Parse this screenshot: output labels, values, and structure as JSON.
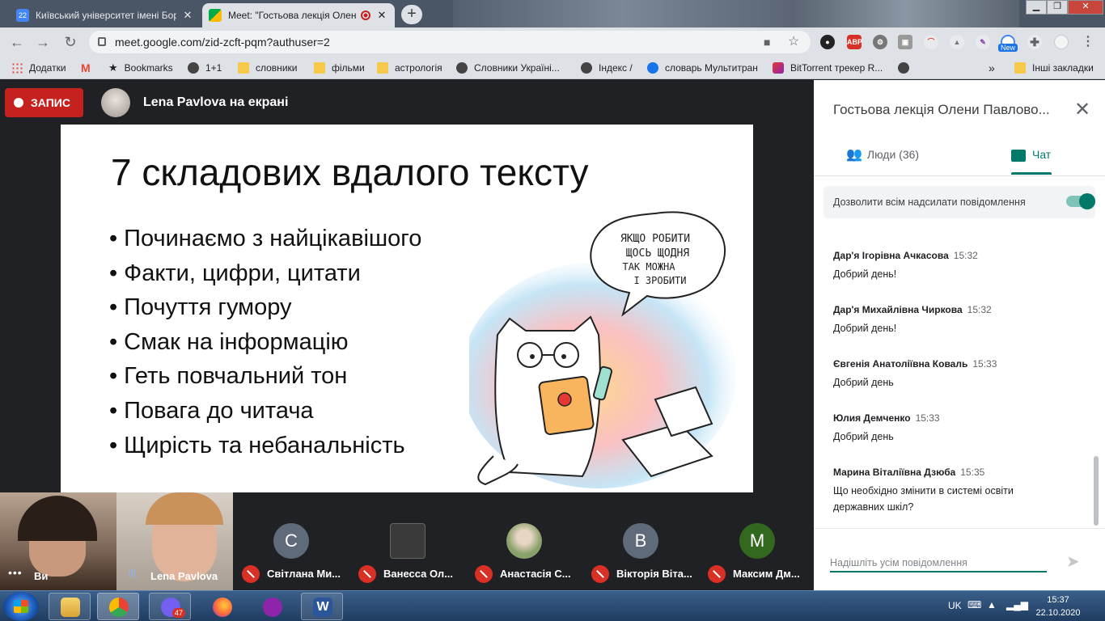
{
  "browser": {
    "tabs": [
      {
        "title": "Київський університет імені Бор",
        "active": false,
        "favicon_color": "#4285f4",
        "favicon_text": "22"
      },
      {
        "title": "Meet: \"Гостьова лекція Олен",
        "active": true,
        "favicon_color": "#00ac47",
        "recording": true
      }
    ],
    "window_controls": [
      "minimize",
      "restore",
      "close"
    ],
    "url": "meet.google.com/zid-zcft-pqm?authuser=2",
    "extension_new_badge": "New",
    "bookmarks": [
      {
        "label": "Додатки",
        "icon": "apps-grid-icon"
      },
      {
        "label": "",
        "icon": "gmail-icon"
      },
      {
        "label": "Bookmarks",
        "icon": "star-icon"
      },
      {
        "label": "1+1",
        "icon": "globe-icon"
      },
      {
        "label": "словники",
        "icon": "folder-icon"
      },
      {
        "label": "фільми",
        "icon": "folder-icon"
      },
      {
        "label": "астрологія",
        "icon": "folder-icon"
      },
      {
        "label": "Словники Україні...",
        "icon": "globe-icon"
      },
      {
        "label": "Індекс /",
        "icon": "globe-icon"
      },
      {
        "label": "словарь Мультитран",
        "icon": "multitran-icon"
      },
      {
        "label": "BitTorrent трекер R...",
        "icon": "bittorrent-icon"
      },
      {
        "label": "",
        "icon": "globe-icon"
      }
    ],
    "bookmarks_overflow": "»",
    "other_bookmarks": "Інші закладки"
  },
  "meet": {
    "record_label": "ЗАПИС",
    "presenter": "Lena Pavlova на екрані",
    "slide": {
      "title": "7 складових вдалого тексту",
      "bullets": [
        "Починаємо з найцікавішого",
        "Факти, цифри, цитати",
        "Почуття гумору",
        "Смак на інформацію",
        "Геть повчальний тон",
        "Повага до читача",
        "Щирість та небанальність"
      ],
      "speech_bubble": [
        "ЯКЩО РОБИТИ",
        "ЩОСЬ ЩОДНЯ",
        "ТАК МОЖНА",
        "І ЗРОБИТИ"
      ]
    },
    "self_tiles": [
      {
        "name": "Ви"
      },
      {
        "name": "Lena Pavlova"
      }
    ],
    "participants": [
      {
        "initial": "С",
        "name": "Світлана Ми...",
        "color": "#5f6b7a",
        "muted": true
      },
      {
        "initial": "",
        "name": "Ванесса Ол...",
        "color": "#3a3a3a",
        "muted": true
      },
      {
        "initial": "",
        "name": "Анастасія С...",
        "color": "#7a8f5a",
        "muted": true
      },
      {
        "initial": "В",
        "name": "Вікторія Віта...",
        "color": "#5f6b7a",
        "muted": true
      },
      {
        "initial": "М",
        "name": "Максим Дм...",
        "color": "#33691e",
        "muted": true
      }
    ]
  },
  "panel": {
    "title": "Гостьова лекція Олени Павлово...",
    "tabs": {
      "people": "Люди (36)",
      "chat": "Чат"
    },
    "allow_label": "Дозволити всім надсилати повідомлення",
    "allow_enabled": true,
    "messages": [
      {
        "sender": "Дар'я Ігорівна Ачкасова",
        "time": "15:32",
        "text": "Добрий день!"
      },
      {
        "sender": "Дар'я Михайлівна Чиркова",
        "time": "15:32",
        "text": "Добрий день!"
      },
      {
        "sender": "Євгенія Анатоліївна Коваль",
        "time": "15:33",
        "text": "Добрий день"
      },
      {
        "sender": "Юлия Демченко",
        "time": "15:33",
        "text": "Добрий день"
      },
      {
        "sender": "Марина Віталіївна Дзюба",
        "time": "15:35",
        "text": "Що необхідно змінити в системі освіти державних шкіл?"
      }
    ],
    "compose_placeholder": "Надішліть усім повідомлення"
  },
  "taskbar": {
    "apps": [
      "explorer",
      "chrome",
      "viber",
      "firefox",
      "podcast",
      "word"
    ],
    "viber_badge": "47",
    "language": "UK",
    "time": "15:37",
    "date": "22.10.2020"
  }
}
